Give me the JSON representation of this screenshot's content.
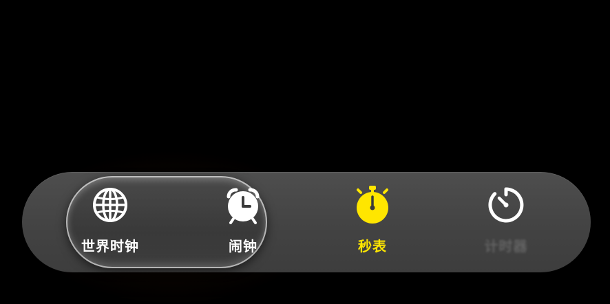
{
  "tabbar": {
    "items": [
      {
        "label": "世界时钟",
        "icon": "globe-icon",
        "state": "selected"
      },
      {
        "label": "闹钟",
        "icon": "alarm-clock-icon",
        "state": "normal"
      },
      {
        "label": "秒表",
        "icon": "stopwatch-icon",
        "state": "active"
      },
      {
        "label": "计时器",
        "icon": "timer-icon",
        "state": "dim"
      }
    ]
  },
  "colors": {
    "accent": "#ffe600",
    "bar_background": "#474747",
    "text": "#ffffff",
    "page_background": "#000000"
  }
}
